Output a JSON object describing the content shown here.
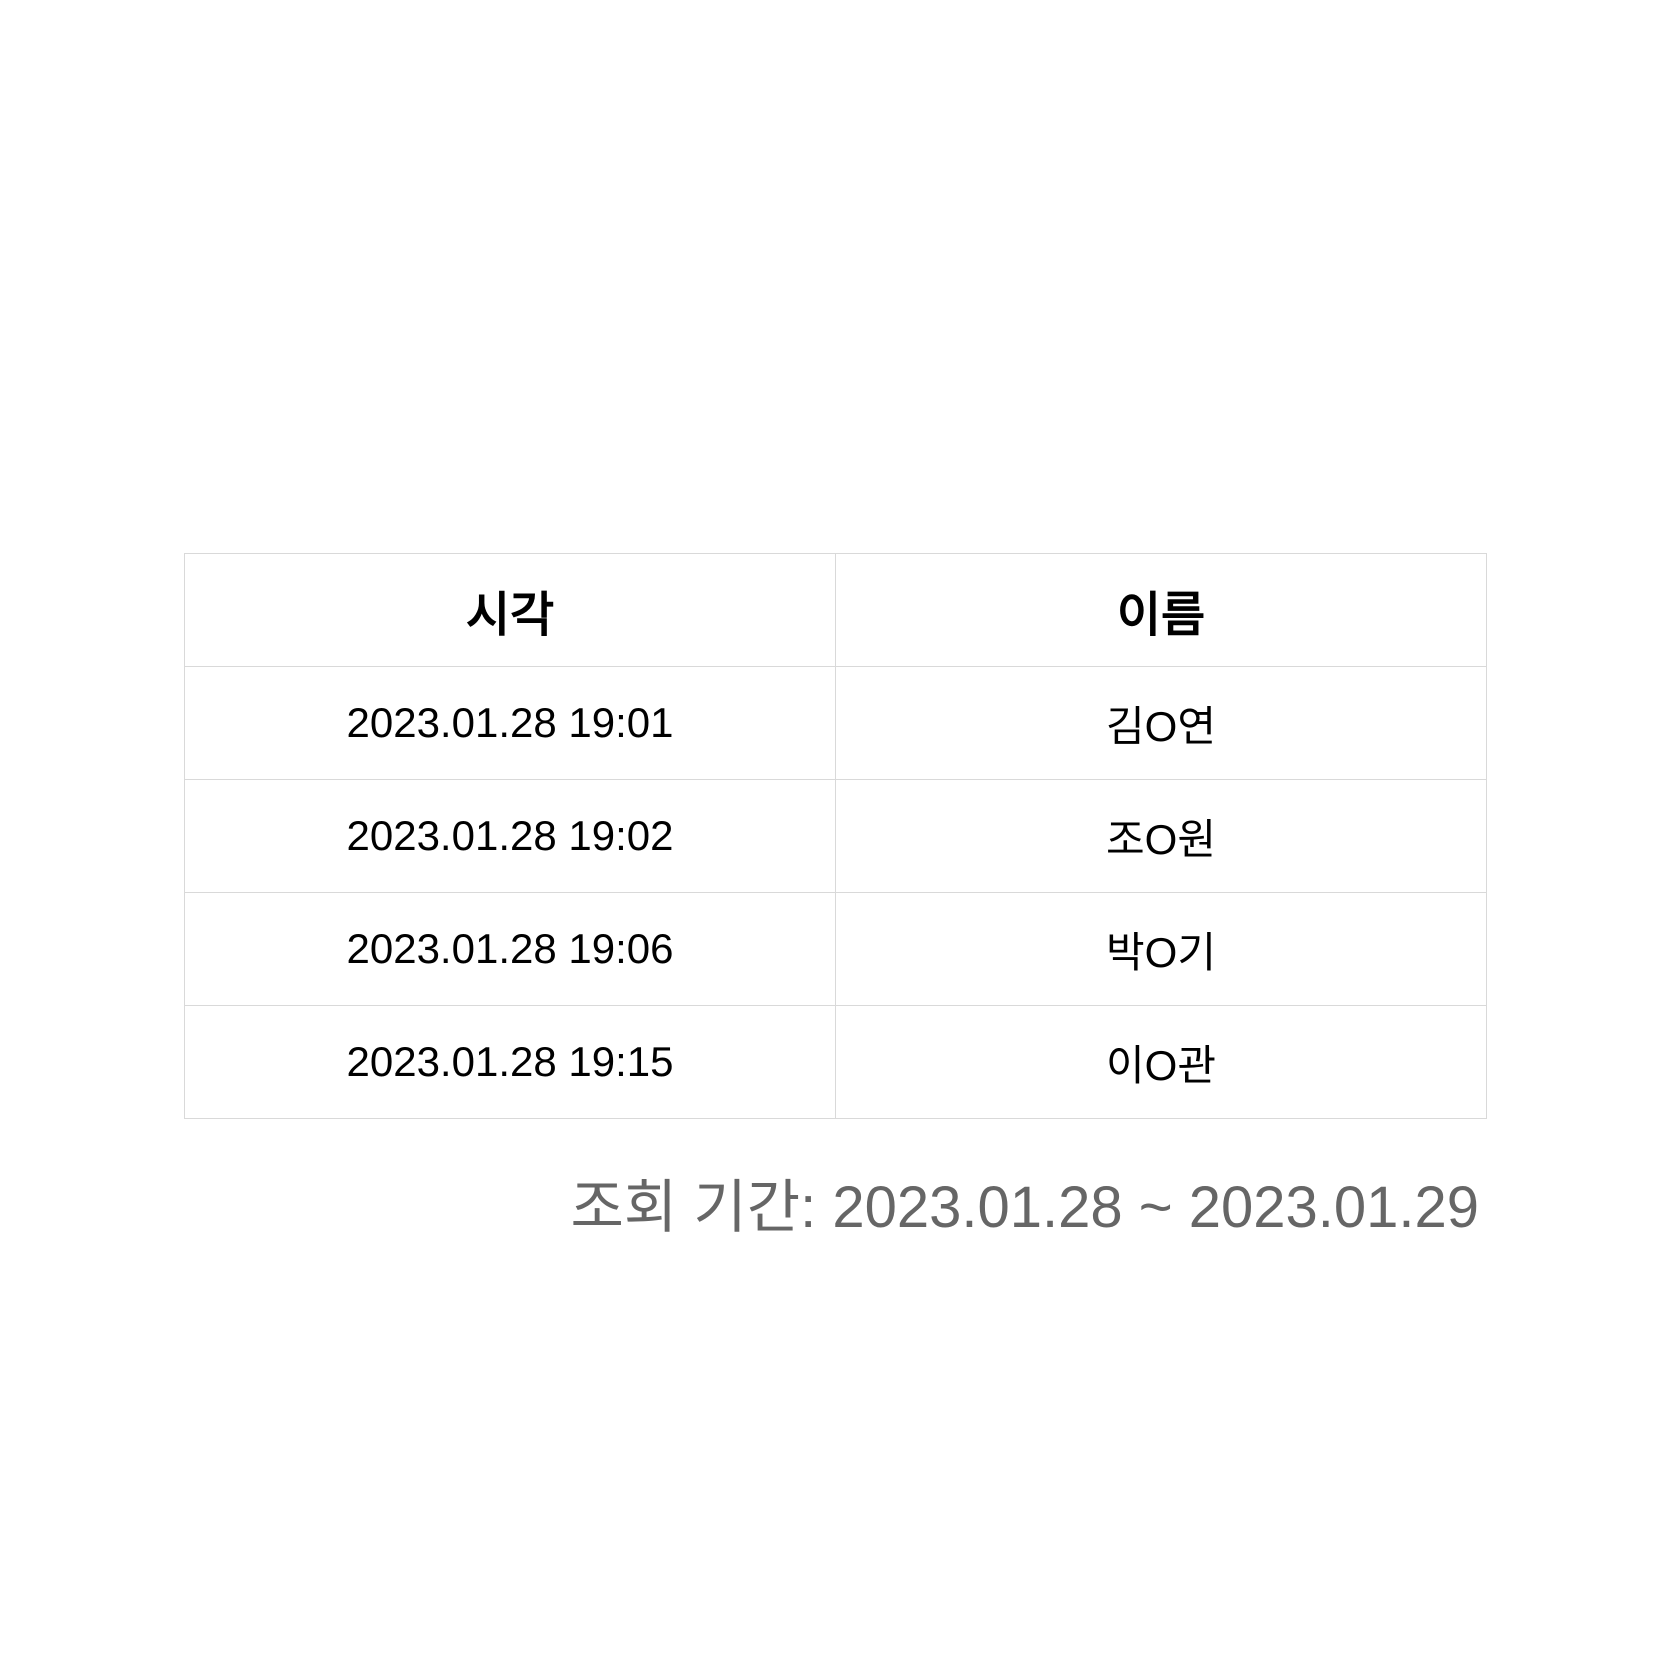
{
  "table": {
    "headers": [
      "시각",
      "이름"
    ],
    "rows": [
      [
        "2023.01.28 19:01",
        "김O연"
      ],
      [
        "2023.01.28 19:02",
        "조O원"
      ],
      [
        "2023.01.28 19:06",
        "박O기"
      ],
      [
        "2023.01.28 19:15",
        "이O관"
      ]
    ]
  },
  "footer": {
    "period_text": "조회 기간: 2023.01.28 ~ 2023.01.29"
  },
  "colors": {
    "border": "#d9d9d9",
    "footer_text": "#666666"
  }
}
